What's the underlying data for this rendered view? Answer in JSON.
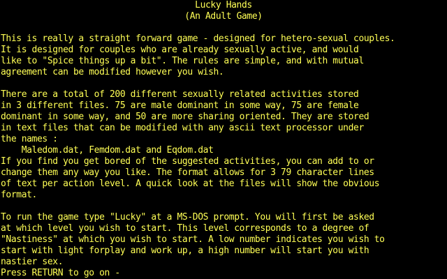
{
  "colors": {
    "background": "#000000",
    "text": "#ffff55"
  },
  "header": {
    "title": "Lucky Hands",
    "subtitle": "(An Adult Game)"
  },
  "intro": {
    "lines": [
      "This is really a straight forward game - designed for hetero-sexual couples.",
      "It is designed for couples who are already sexually active, and would",
      "like to \"Spice things up a bit\". The rules are simple, and with mutual",
      "agreement can be modified however you wish."
    ]
  },
  "activities": {
    "lines": [
      "There are a total of 200 different sexually related activities stored",
      "in 3 different files. 75 are male dominant in some way, 75 are female",
      "dominant in some way, and 50 are more sharing oriented. They are stored",
      "in text files that can be modified with any ascii text processor under",
      "the names :",
      "    Maledom.dat, Femdom.dat and Eqdom.dat",
      "If you find you get bored of the suggested activities, you can add to or",
      "change them any way you like. The format allows for 3 79 character lines",
      "of text per action level. A quick look at the files will show the obvious",
      "format."
    ]
  },
  "instructions": {
    "lines": [
      "To run the game type \"Lucky\" at a MS-DOS prompt. You will first be asked",
      "at which level you wish to start. This level corresponds to a degree of",
      "\"Nastiness\" at which you wish to start. A low number indicates you wish to",
      "start with light forplay and work up, a high number will start you with",
      "nastier sex."
    ]
  },
  "prompt": {
    "text": "Press RETURN to go on -"
  }
}
